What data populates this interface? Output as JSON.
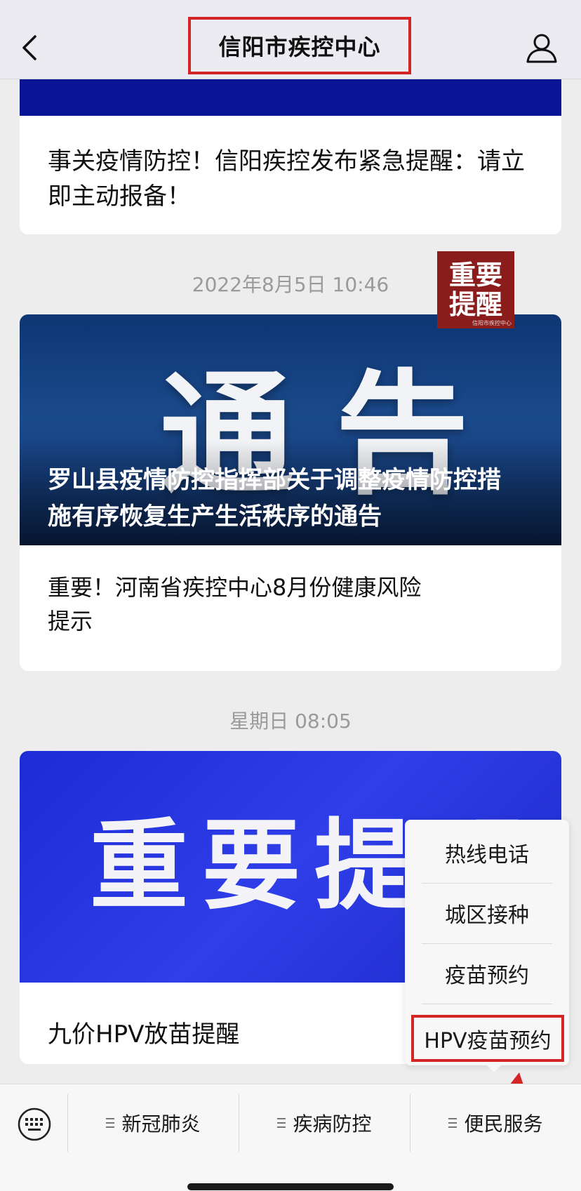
{
  "header": {
    "title": "信阳市疾控中心",
    "back_icon": "chevron-left-icon",
    "profile_icon": "person-icon",
    "highlight_color": "#d32525"
  },
  "feed": {
    "card1": {
      "banner_color": "#0a1596",
      "title": "事关疫情防控！信阳疾控发布紧急提醒：请立即主动报备！"
    },
    "timestamp1": "2022年8月5日 10:46",
    "card2": {
      "hero_text": "通告",
      "hero_title": "罗山县疫情防控指挥部关于调整疫情防控措施有序恢复生产生活秩序的通告",
      "sub_title": "重要！河南省疾控中心8月份健康风险提示",
      "thumb_line1": "重要",
      "thumb_line2": "提醒",
      "thumb_watermark": "信阳市疾控中心"
    },
    "timestamp2": "星期日 08:05",
    "card3": {
      "hero_text": "重要提醒",
      "title": "九价HPV放苗提醒"
    }
  },
  "popup_menu": {
    "items": [
      "热线电话",
      "城区接种",
      "疫苗预约",
      "HPV疫苗预约"
    ],
    "highlighted_index": 3
  },
  "bottom_menu": {
    "keyboard_icon": "keyboard-icon",
    "items": [
      "新冠肺炎",
      "疾病防控",
      "便民服务"
    ]
  }
}
